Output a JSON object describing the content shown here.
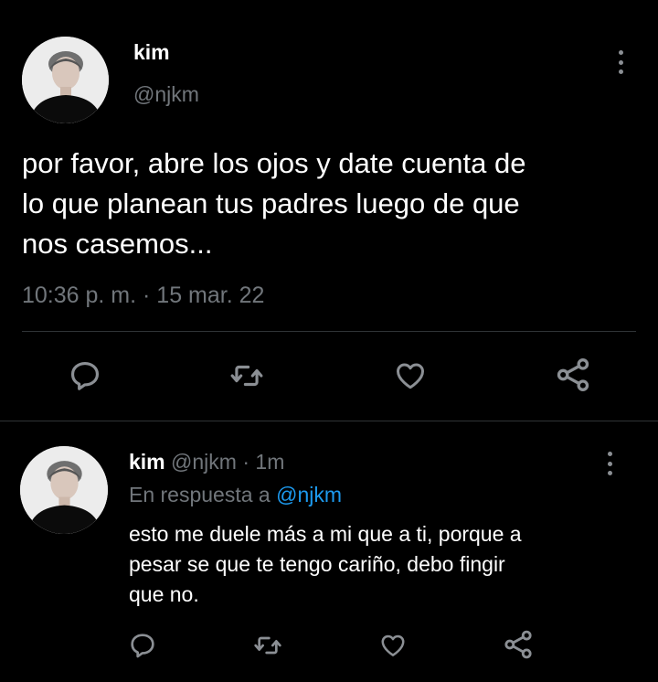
{
  "main_tweet": {
    "display_name": "kim",
    "handle": "@njkm",
    "text_lines": [
      "por favor, abre los ojos y date cuenta de",
      "lo que planean tus padres luego de que",
      "nos casemos..."
    ],
    "timestamp": "10:36 p. m. · 15 mar. 22",
    "avatar_icon": "avatar-icon"
  },
  "reply_tweet": {
    "display_name": "kim",
    "handle": "@njkm",
    "separator": "·",
    "time_ago": "1m",
    "replying_to_label": "En respuesta a",
    "replying_to_handle": "@njkm",
    "text_lines": [
      "esto me duele más a mi que a ti, porque a",
      "pesar se que te tengo cariño, debo fingir",
      "que no."
    ],
    "avatar_icon": "avatar-icon"
  },
  "actions": [
    "reply-icon",
    "retweet-icon",
    "like-icon",
    "share-icon"
  ],
  "colors": {
    "background": "#000000",
    "text": "#e7e9ea",
    "muted": "#71767b",
    "link": "#1d9bf0",
    "divider": "#2f3336"
  }
}
